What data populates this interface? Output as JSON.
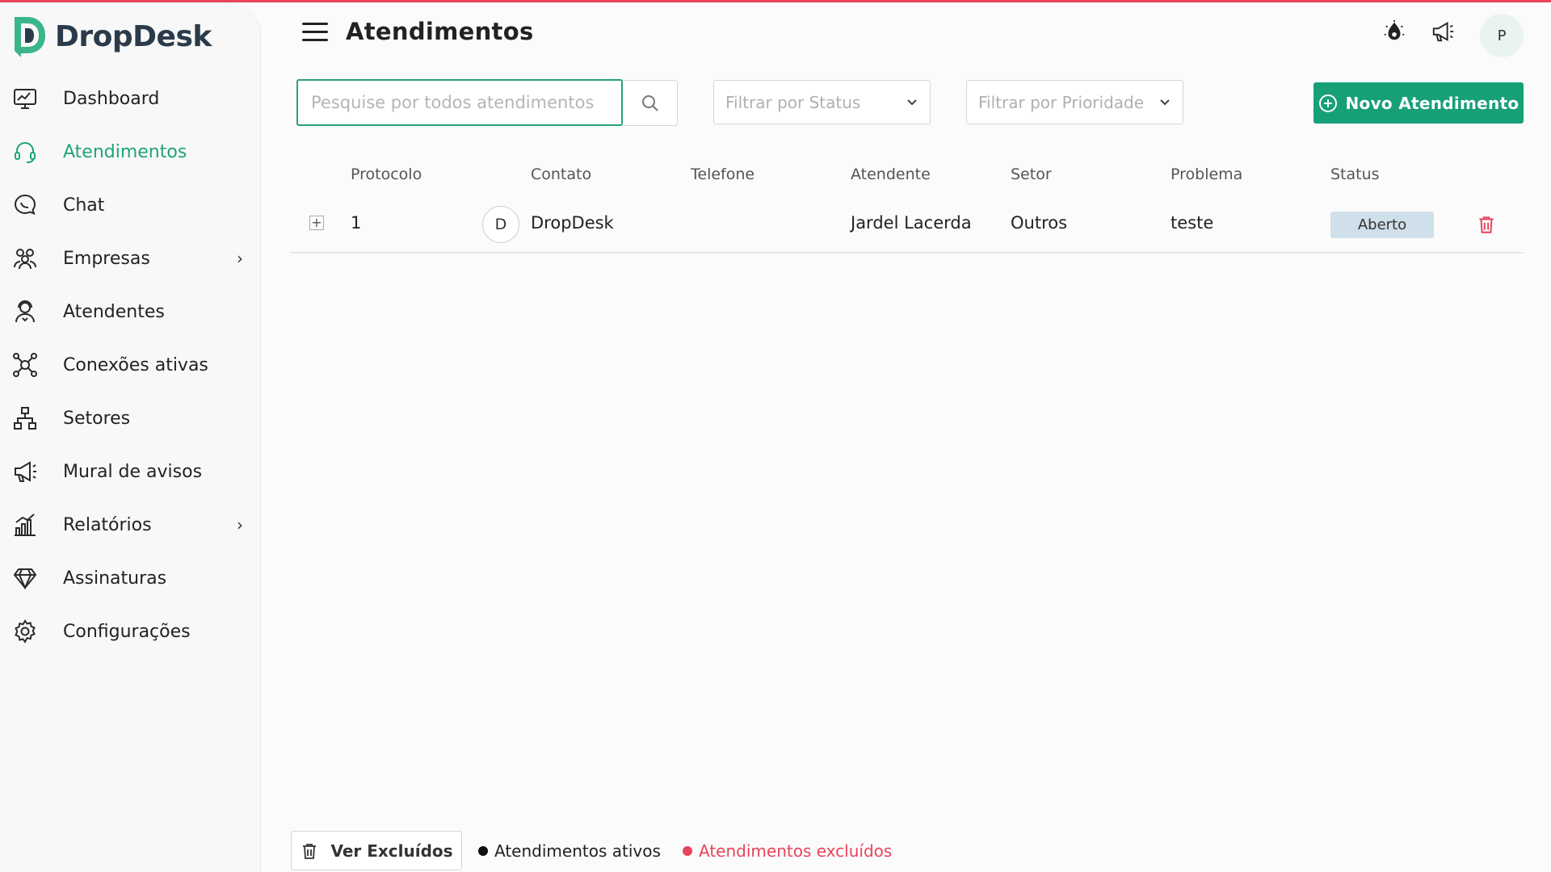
{
  "brand": {
    "name": "DropDesk",
    "accent": "#1fa37b",
    "danger": "#e8445a"
  },
  "sidebar": {
    "items": [
      {
        "label": "Dashboard",
        "icon": "dashboard-icon"
      },
      {
        "label": "Atendimentos",
        "icon": "headset-icon",
        "active": true
      },
      {
        "label": "Chat",
        "icon": "chat-icon"
      },
      {
        "label": "Empresas",
        "icon": "companies-icon",
        "chevron": "›"
      },
      {
        "label": "Atendentes",
        "icon": "attendant-icon"
      },
      {
        "label": "Conexões ativas",
        "icon": "connections-icon"
      },
      {
        "label": "Setores",
        "icon": "sectors-icon"
      },
      {
        "label": "Mural de avisos",
        "icon": "megaphone-icon"
      },
      {
        "label": "Relatórios",
        "icon": "reports-icon",
        "chevron": "›"
      },
      {
        "label": "Assinaturas",
        "icon": "diamond-icon"
      },
      {
        "label": "Configurações",
        "icon": "gear-icon"
      }
    ]
  },
  "header": {
    "title": "Atendimentos",
    "avatar_initial": "P"
  },
  "toolbar": {
    "search_placeholder": "Pesquise por todos atendimentos",
    "status_filter": "Filtrar por Status",
    "priority_filter": "Filtrar por Prioridade",
    "new_button": "Novo Atendimento"
  },
  "table": {
    "columns": [
      "Protocolo",
      "Contato",
      "Telefone",
      "Atendente",
      "Setor",
      "Problema",
      "Status"
    ],
    "rows": [
      {
        "expand": "+",
        "protocolo": "1",
        "contact_initial": "D",
        "contato": "DropDesk",
        "telefone": "",
        "atendente": "Jardel Lacerda",
        "setor": "Outros",
        "problema": "teste",
        "status": "Aberto"
      }
    ]
  },
  "footer": {
    "ver_excluidos": "Ver Excluídos",
    "legend_active": "Atendimentos ativos",
    "legend_deleted": "Atendimentos excluídos"
  }
}
